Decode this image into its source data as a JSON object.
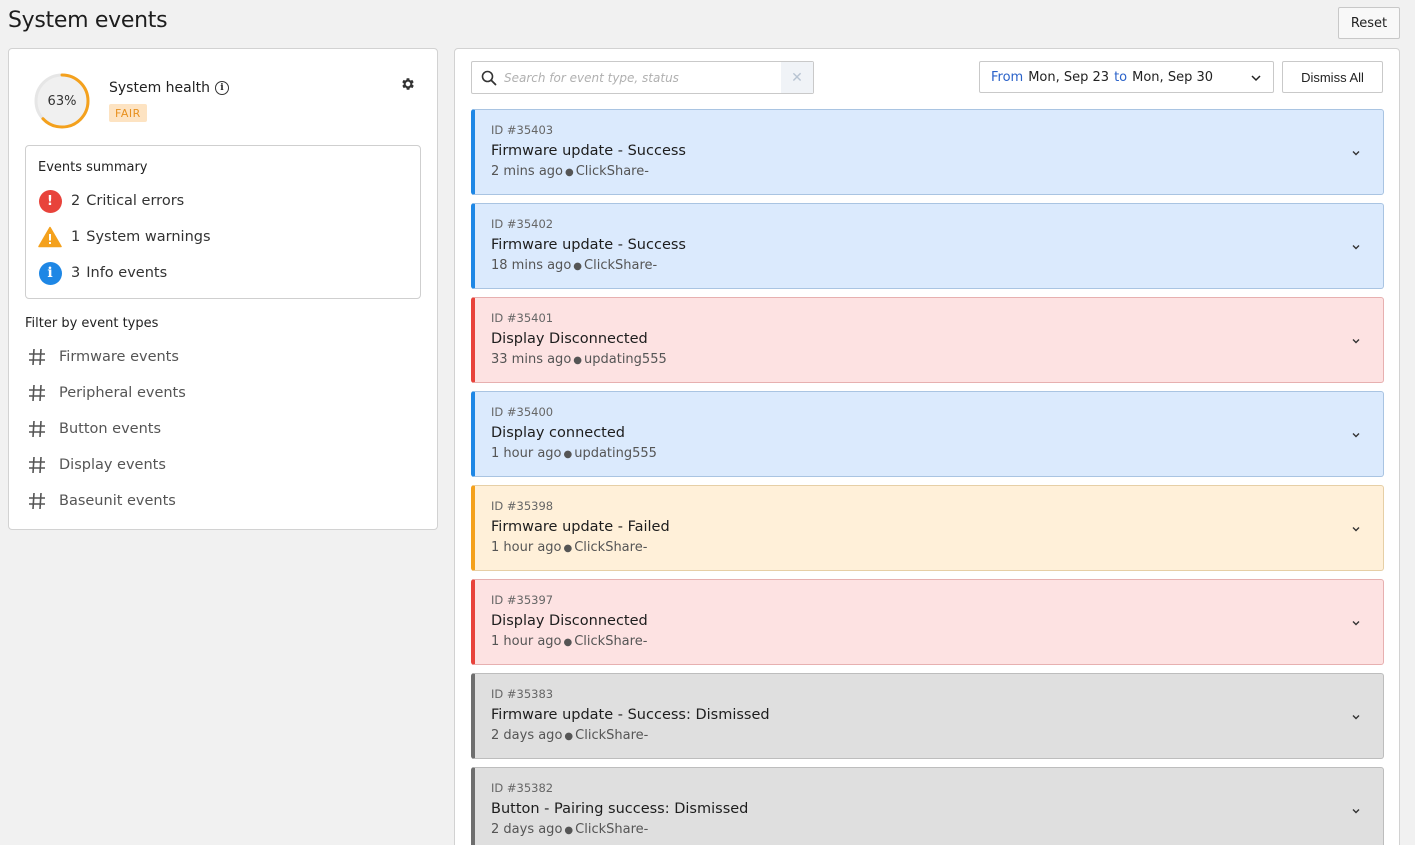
{
  "header": {
    "title": "System events",
    "reset_label": "Reset"
  },
  "health": {
    "percent_label": "63%",
    "percent_value": 0.63,
    "title": "System health",
    "status": "FAIR",
    "gauge_color": "#f4a11d"
  },
  "summary": {
    "title": "Events summary",
    "rows": [
      {
        "count": "2",
        "label": "Critical errors",
        "icon": "critical-error-icon",
        "color": "#e8433b"
      },
      {
        "count": "1",
        "label": "System warnings",
        "icon": "warning-icon",
        "color": "#f4a11d"
      },
      {
        "count": "3",
        "label": "Info events",
        "icon": "info-icon",
        "color": "#1e87e5"
      }
    ]
  },
  "filters": {
    "title": "Filter by event types",
    "items": [
      "Firmware events",
      "Peripheral events",
      "Button events",
      "Display events",
      "Baseunit events"
    ]
  },
  "toolbar": {
    "search_placeholder": "Search for event type, status",
    "search_value": "",
    "date_from_label": "From",
    "date_from": "Mon, Sep 23",
    "date_to_label": "to",
    "date_to": "Mon, Sep 30",
    "dismiss_all_label": "Dismiss All"
  },
  "events": [
    {
      "id": "ID #35403",
      "title": "Firmware update - Success",
      "time": "2 mins ago",
      "source": "ClickShare-",
      "severity": "info"
    },
    {
      "id": "ID #35402",
      "title": "Firmware update - Success",
      "time": "18 mins ago",
      "source": "ClickShare-",
      "severity": "info"
    },
    {
      "id": "ID #35401",
      "title": "Display Disconnected",
      "time": "33 mins ago",
      "source": "updating555",
      "severity": "critical"
    },
    {
      "id": "ID #35400",
      "title": "Display connected",
      "time": "1 hour ago",
      "source": "updating555",
      "severity": "info"
    },
    {
      "id": "ID #35398",
      "title": "Firmware update - Failed",
      "time": "1 hour ago",
      "source": "ClickShare-",
      "severity": "warning"
    },
    {
      "id": "ID #35397",
      "title": "Display Disconnected",
      "time": "1 hour ago",
      "source": "ClickShare-",
      "severity": "critical"
    },
    {
      "id": "ID #35383",
      "title": "Firmware update - Success: Dismissed",
      "time": "2 days ago",
      "source": "ClickShare-",
      "severity": "dismissed"
    },
    {
      "id": "ID #35382",
      "title": "Button - Pairing success: Dismissed",
      "time": "2 days ago",
      "source": "ClickShare-",
      "severity": "dismissed"
    }
  ]
}
